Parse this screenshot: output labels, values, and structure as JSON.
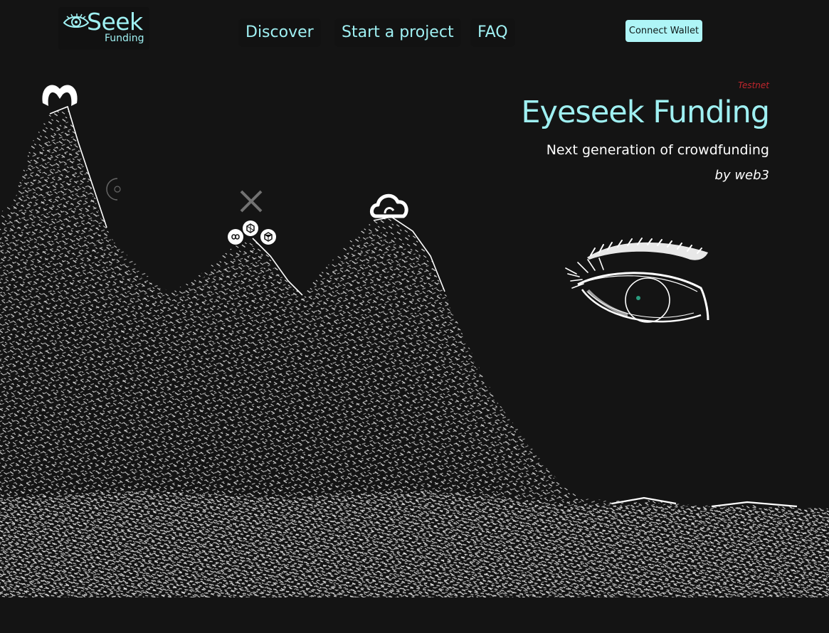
{
  "header": {
    "logo": {
      "word": "Seek",
      "sub": "Funding"
    },
    "nav": [
      {
        "label": "Discover"
      },
      {
        "label": "Start a project"
      },
      {
        "label": "FAQ"
      }
    ],
    "connect_label": "Connect Wallet"
  },
  "hero": {
    "network_badge": "Testnet",
    "title": "Eyeseek Funding",
    "subtitle": "Next generation of crowdfunding",
    "byline": "by web3"
  },
  "colors": {
    "background": "#141414",
    "accent": "#9ff0f2",
    "button_bg": "#aef5f7",
    "badge": "#c0262d",
    "pupil": "#2a9d7f"
  },
  "illustration": {
    "peak_icons": [
      "moonbeam-icon",
      "blocked-chain-icon",
      "polygon-icon",
      "bnb-icon",
      "cube-icon",
      "cloud-icon",
      "partial-circle-icon"
    ]
  }
}
